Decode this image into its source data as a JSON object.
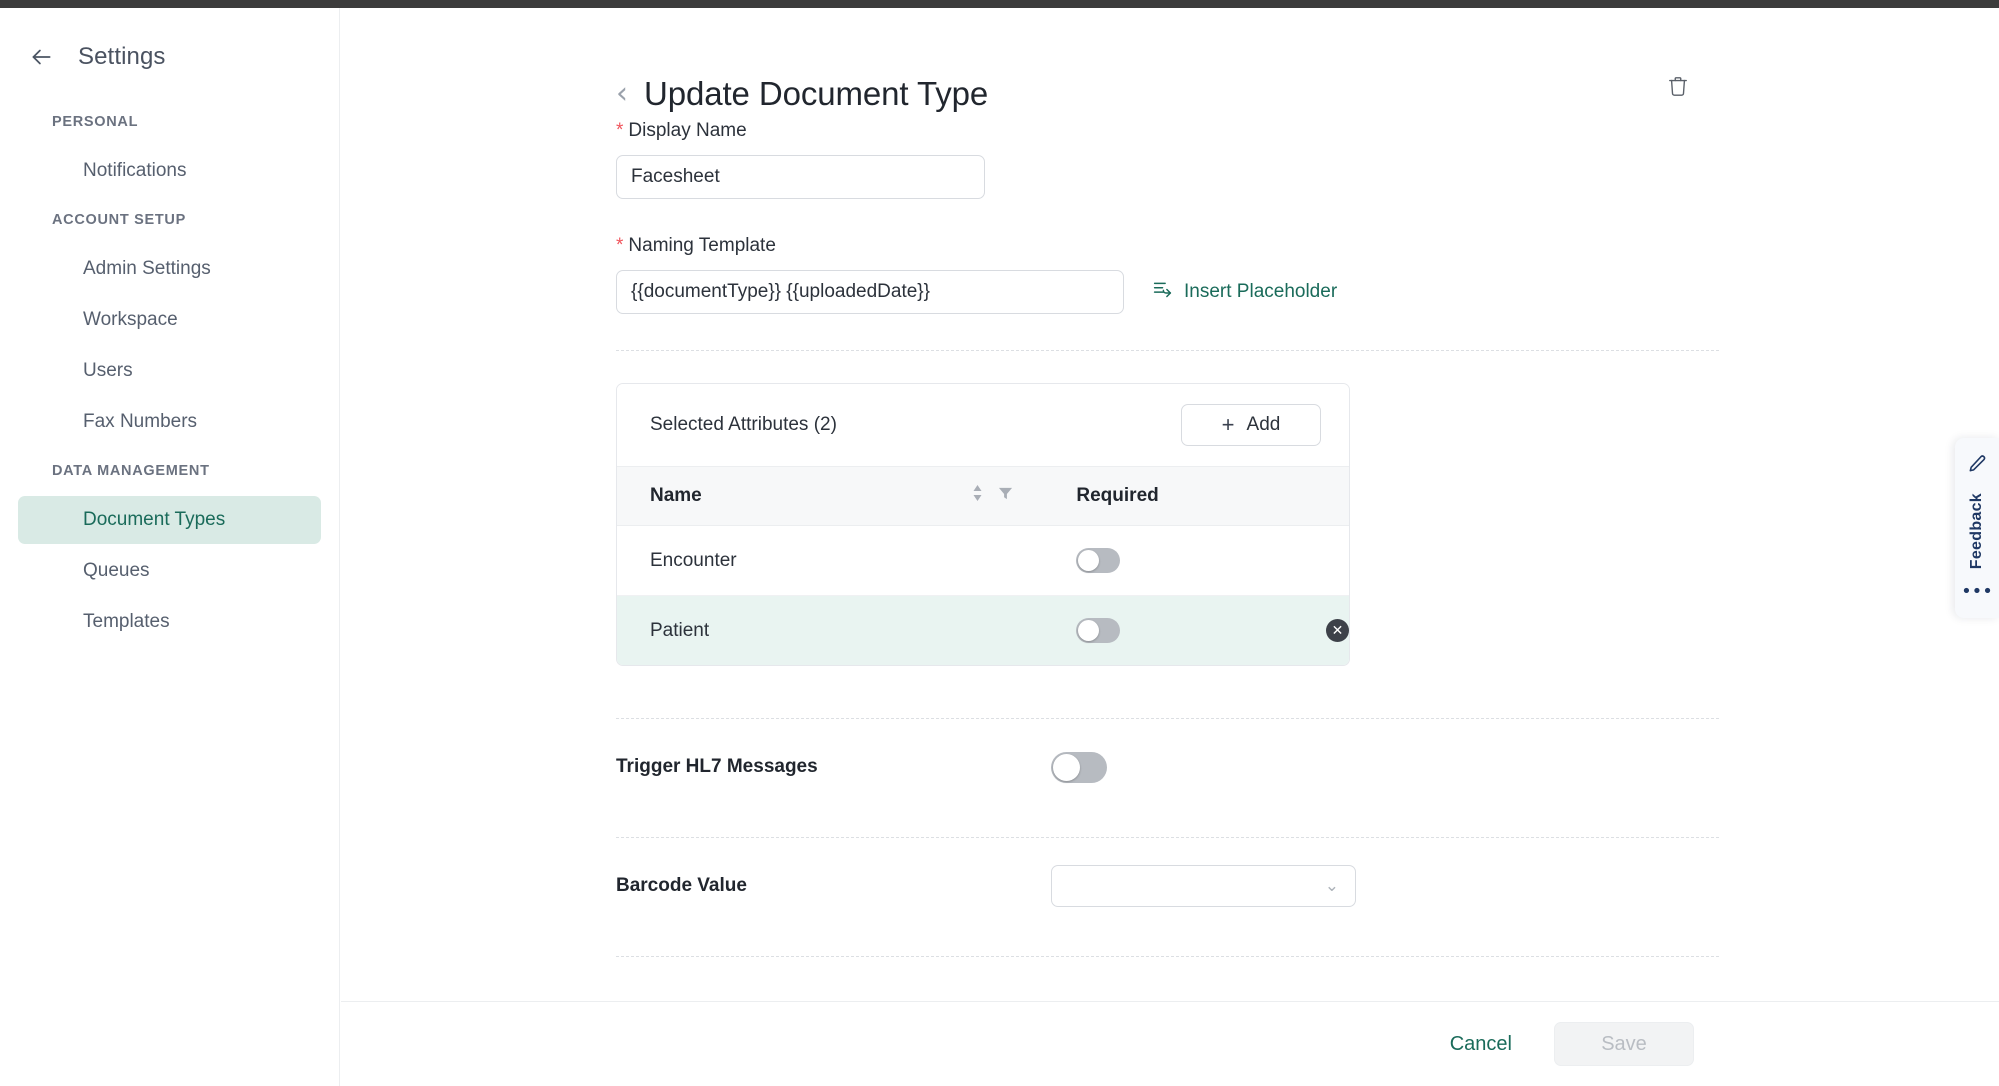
{
  "sidebar": {
    "title": "Settings",
    "back_icon": "arrow-left-icon",
    "groups": [
      {
        "label": "PERSONAL",
        "items": [
          {
            "label": "Notifications",
            "active": false
          }
        ]
      },
      {
        "label": "ACCOUNT SETUP",
        "items": [
          {
            "label": "Admin Settings",
            "active": false
          },
          {
            "label": "Workspace",
            "active": false
          },
          {
            "label": "Users",
            "active": false
          },
          {
            "label": "Fax Numbers",
            "active": false
          }
        ]
      },
      {
        "label": "DATA MANAGEMENT",
        "items": [
          {
            "label": "Document Types",
            "active": true
          },
          {
            "label": "Queues",
            "active": false
          },
          {
            "label": "Templates",
            "active": false
          }
        ]
      }
    ]
  },
  "header": {
    "back_chevron": "‹",
    "title": "Update Document Type",
    "delete_icon": "trash-icon"
  },
  "form": {
    "display_name": {
      "label": "Display Name",
      "required_marker": "*",
      "value": "Facesheet",
      "placeholder": "Display Name"
    },
    "naming_template": {
      "label": "Naming Template",
      "required_marker": "*",
      "value": "{{documentType}} {{uploadedDate}}",
      "placeholder": "Naming Template",
      "insert_placeholder_label": "Insert Placeholder",
      "insert_placeholder_icon": "insert-placeholder-icon"
    },
    "attributes": {
      "title": "Selected Attributes (2)",
      "add_label": "Add",
      "add_icon": "plus-icon",
      "columns": [
        "Name",
        "Required"
      ],
      "sort_icon": "sort-icon",
      "filter_icon": "filter-icon",
      "rows": [
        {
          "name": "Encounter",
          "required": false,
          "highlighted": false,
          "removable": false
        },
        {
          "name": "Patient",
          "required": false,
          "highlighted": true,
          "removable": true
        }
      ],
      "remove_icon": "remove-circle-icon"
    },
    "trigger_hl7": {
      "label": "Trigger HL7 Messages",
      "enabled": false
    },
    "barcode_value": {
      "label": "Barcode Value",
      "value": "",
      "placeholder": "",
      "chevron": "⌄"
    }
  },
  "footer": {
    "cancel_label": "Cancel",
    "save_label": "Save",
    "save_disabled": true
  },
  "feedback": {
    "label": "Feedback",
    "icon": "pencil-icon",
    "more": "•••"
  },
  "colors": {
    "accent_teal": "#1a6b5a",
    "active_nav_bg": "#d9eae5",
    "row_highlight": "#e9f4f1",
    "required_star": "#f0555d",
    "feedback_navy": "#1f3864"
  }
}
